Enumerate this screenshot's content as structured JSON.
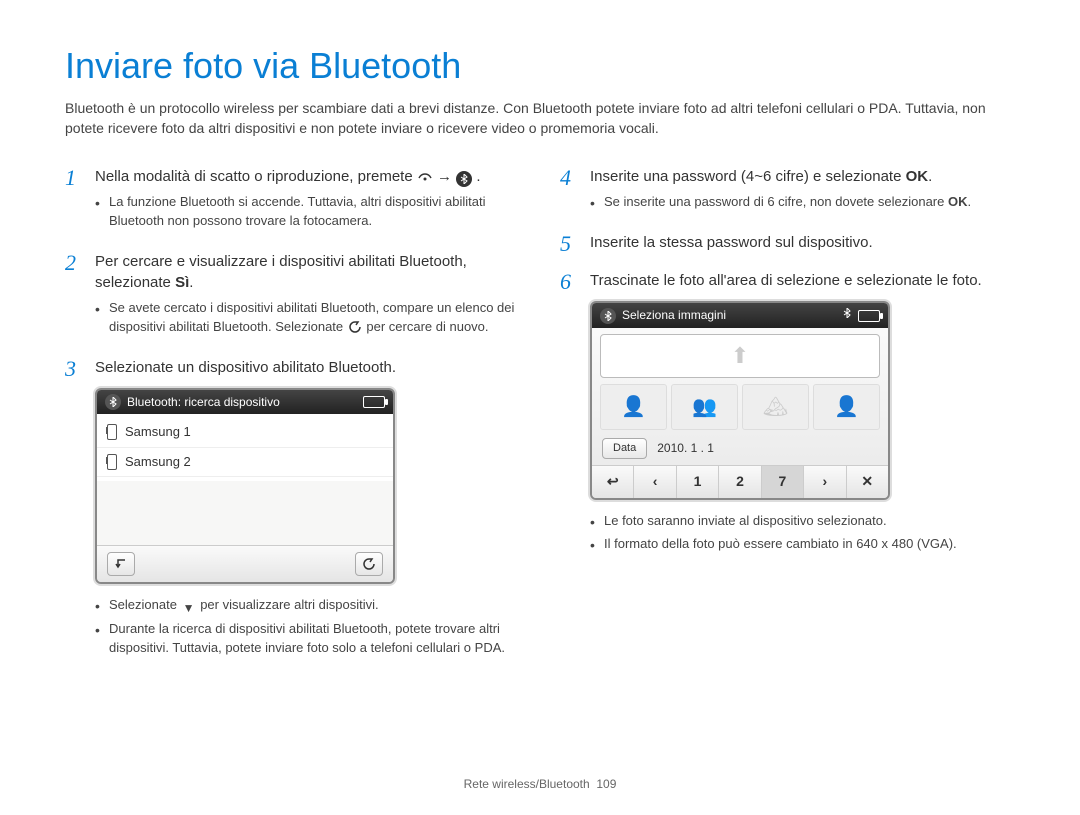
{
  "title": "Inviare foto via Bluetooth",
  "intro": "Bluetooth è un protocollo wireless per scambiare dati a brevi distanze. Con Bluetooth potete inviare foto ad altri telefoni cellulari o PDA. Tuttavia, non potete ricevere foto da altri dispositivi e non potete inviare o ricevere video o promemoria vocali.",
  "left": {
    "step1": {
      "num": "1",
      "text_a": "Nella modalità di scatto o riproduzione, premete ",
      "text_b": " → ",
      "text_c": ".",
      "bullets": [
        "La funzione Bluetooth si accende. Tuttavia, altri dispositivi abilitati Bluetooth non possono trovare la fotocamera."
      ]
    },
    "step2": {
      "num": "2",
      "text_a": "Per cercare e visualizzare i dispositivi abilitati Bluetooth, selezionate ",
      "bold": "Sì",
      "text_b": ".",
      "bullets_a": "Se avete cercato i dispositivi abilitati Bluetooth, compare un elenco dei dispositivi abilitati Bluetooth. Selezionate ",
      "bullets_b": " per cercare di nuovo."
    },
    "step3": {
      "num": "3",
      "text": "Selezionate un dispositivo abilitato Bluetooth."
    },
    "after3_bullets_a": "Selezionate ",
    "after3_bullets_b": " per visualizzare altri dispositivi.",
    "after3_bullets_c": "Durante la ricerca di dispositivi abilitati Bluetooth, potete trovare altri dispositivi. Tuttavia, potete inviare foto solo a telefoni cellulari o PDA."
  },
  "right": {
    "step4": {
      "num": "4",
      "text_a": "Inserite una password (4~6 cifre) e selezionate ",
      "bold": "OK",
      "text_b": ".",
      "bullets_a": "Se inserite una password di 6 cifre, non dovete selezionare ",
      "bullets_bold": "OK",
      "bullets_b": "."
    },
    "step5": {
      "num": "5",
      "text": "Inserite la stessa password sul dispositivo."
    },
    "step6": {
      "num": "6",
      "text": "Trascinate le foto all'area di selezione e selezionate le foto."
    },
    "after6_bullets": [
      "Le foto saranno inviate al dispositivo selezionato.",
      "Il formato della foto può essere cambiato in 640 x 480 (VGA)."
    ]
  },
  "device1": {
    "header": "Bluetooth: ricerca dispositivo",
    "rows": [
      "Samsung 1",
      "Samsung 2"
    ]
  },
  "device2": {
    "header": "Seleziona immagini",
    "data_label": "Data",
    "date": "2010. 1 . 1",
    "footer": [
      "↩",
      "‹",
      "1",
      "2",
      "7",
      "›",
      "✕"
    ],
    "selected_index": 4
  },
  "footer": {
    "section": "Rete wireless/Bluetooth",
    "page": "109"
  }
}
